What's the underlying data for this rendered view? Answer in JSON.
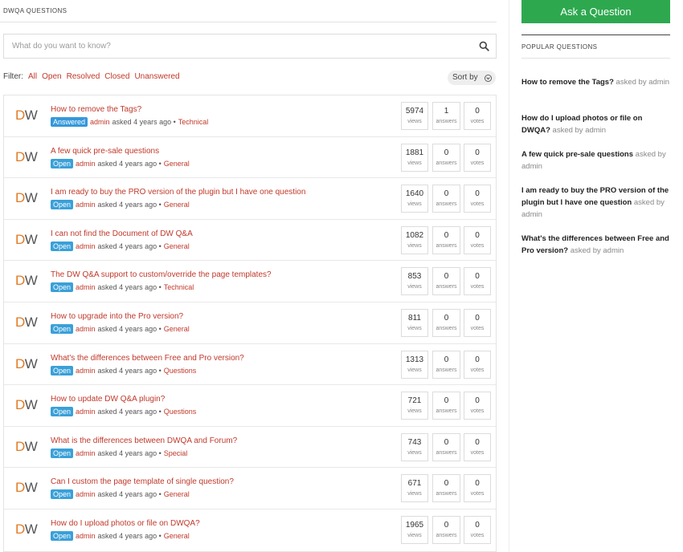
{
  "header": {
    "section_title": "DWQA QUESTIONS"
  },
  "search": {
    "placeholder": "What do you want to know?"
  },
  "filter": {
    "label": "Filter:",
    "options": [
      "All",
      "Open",
      "Resolved",
      "Closed",
      "Unanswered"
    ]
  },
  "sort": {
    "label": "Sort by"
  },
  "avatar_text": {
    "first": "D",
    "second": "W"
  },
  "stat_labels": {
    "views": "views",
    "answers": "answers",
    "votes": "votes"
  },
  "asked_text": "asked 4 years ago •",
  "questions": [
    {
      "title": "How to remove the Tags?",
      "status": "Answered",
      "author": "admin",
      "category": "Technical",
      "views": "5974",
      "answers": "1",
      "votes": "0"
    },
    {
      "title": "A few quick pre-sale questions",
      "status": "Open",
      "author": "admin",
      "category": "General",
      "views": "1881",
      "answers": "0",
      "votes": "0"
    },
    {
      "title": "I am ready to buy the PRO version of the plugin but I have one question",
      "status": "Open",
      "author": "admin",
      "category": "General",
      "views": "1640",
      "answers": "0",
      "votes": "0"
    },
    {
      "title": "I can not find the Document of DW Q&A",
      "status": "Open",
      "author": "admin",
      "category": "General",
      "views": "1082",
      "answers": "0",
      "votes": "0"
    },
    {
      "title": "The DW Q&A support to custom/override the page templates?",
      "status": "Open",
      "author": "admin",
      "category": "Technical",
      "views": "853",
      "answers": "0",
      "votes": "0"
    },
    {
      "title": "How to upgrade into the Pro version?",
      "status": "Open",
      "author": "admin",
      "category": "General",
      "views": "811",
      "answers": "0",
      "votes": "0"
    },
    {
      "title": "What's the differences between Free and Pro version?",
      "status": "Open",
      "author": "admin",
      "category": "Questions",
      "views": "1313",
      "answers": "0",
      "votes": "0"
    },
    {
      "title": "How to update DW Q&A plugin?",
      "status": "Open",
      "author": "admin",
      "category": "Questions",
      "views": "721",
      "answers": "0",
      "votes": "0"
    },
    {
      "title": "What is the differences between DWQA and Forum?",
      "status": "Open",
      "author": "admin",
      "category": "Special",
      "views": "743",
      "answers": "0",
      "votes": "0"
    },
    {
      "title": "Can I custom the page template of single question?",
      "status": "Open",
      "author": "admin",
      "category": "General",
      "views": "671",
      "answers": "0",
      "votes": "0"
    },
    {
      "title": "How do I upload photos or file on DWQA?",
      "status": "Open",
      "author": "admin",
      "category": "General",
      "views": "1965",
      "answers": "0",
      "votes": "0"
    }
  ],
  "sidebar": {
    "ask_button": "Ask a Question",
    "popular_title": "POPULAR QUESTIONS",
    "popular": [
      {
        "question": "How to remove the Tags?",
        "by": "asked by admin"
      },
      {
        "question": "How do I upload photos or file on DWQA?",
        "by": "asked by admin"
      },
      {
        "question": "A few quick pre-sale questions",
        "by": "asked by admin"
      },
      {
        "question": "I am ready to buy the PRO version of the plugin but I have one question",
        "by": "asked by admin"
      },
      {
        "question": "What's the differences between Free and Pro version?",
        "by": "asked by admin"
      }
    ]
  },
  "colors": {
    "accent": "#c0392b",
    "ask_button": "#2ea84f",
    "badge": "#3598db"
  },
  "icons": {
    "search": "search-icon",
    "sort": "chevron-down-icon"
  }
}
